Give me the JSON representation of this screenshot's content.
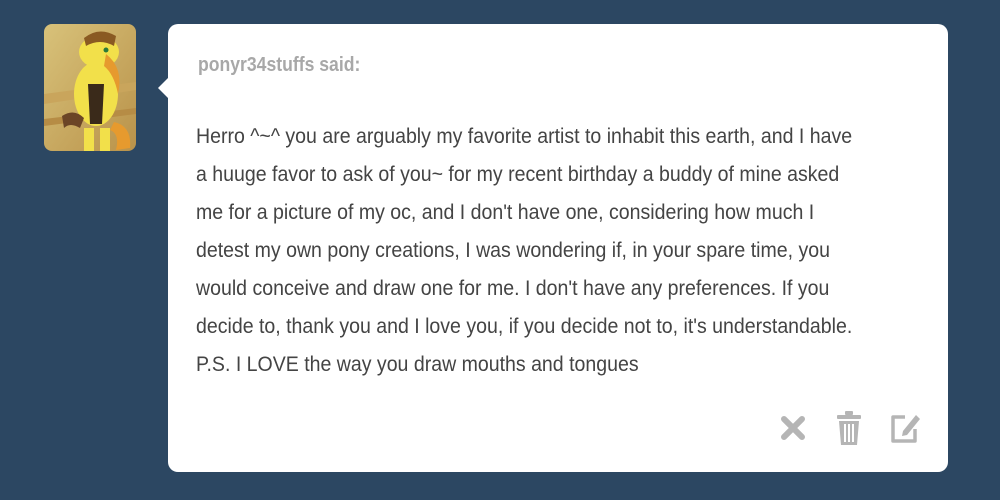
{
  "ask": {
    "asker_name": "ponyr34stuffs",
    "said_label": "ponyr34stuffs said:",
    "question_text": "Herro ^~^ you are arguably my favorite artist to inhabit this earth, and I have a huuge favor to ask of you~ for my recent birthday a buddy of mine asked me for a picture of my oc, and I don't have one, considering how much I detest my own pony creations, I was wondering if, in your spare time, you would conceive and draw one for me. I don't have any preferences. If you decide to, thank you and I love you, if you decide not to, it's understandable. P.S. I LOVE the way you draw mouths and tongues"
  },
  "actions": {
    "icons": [
      "close-icon",
      "trash-icon",
      "edit-icon"
    ]
  },
  "colors": {
    "background": "#2c4762",
    "card": "#ffffff",
    "asker_text": "#a8a8a8",
    "body_text": "#444444",
    "icon": "#b5b5b5"
  }
}
